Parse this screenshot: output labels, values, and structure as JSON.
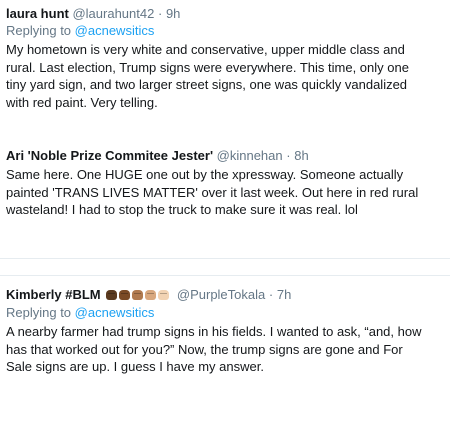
{
  "tweets": [
    {
      "name": "laura hunt",
      "handle": "@laurahunt42",
      "separator": "·",
      "time": "9h",
      "reply_prefix": "Replying to",
      "reply_to": "@acnewsitics",
      "text": "My hometown is very white and conservative, upper middle class and rural. Last election, Trump signs were everywhere. This time, only one tiny yard sign, and two larger street signs, one was quickly vandalized with red paint. Very telling."
    },
    {
      "name": "Ari 'Noble Prize Commitee Jester'",
      "handle": "@kinnehan",
      "separator": "·",
      "time": "8h",
      "text": "Same here. One HUGE one out by the xpressway. Someone actually painted 'TRANS LIVES MATTER' over it last week. Out here in red rural wasteland! I had to stop the truck to make sure it was real. lol"
    },
    {
      "name": "Kimberly #BLM",
      "handle": "@PurpleTokala",
      "separator": "·",
      "time": "7h",
      "reply_prefix": "Replying to",
      "reply_to": "@acnewsitics",
      "text": "A nearby farmer had trump signs in his fields. I wanted to ask, “and, how has that worked out for you?” Now, the trump signs are gone and For Sale signs are up. I guess I have my answer."
    }
  ],
  "emoji": {
    "name": "raised-fist-skin-tones",
    "colors": [
      "#5b3a1f",
      "#7a4a25",
      "#b07a4f",
      "#d9a87e",
      "#f2d3b3"
    ]
  }
}
